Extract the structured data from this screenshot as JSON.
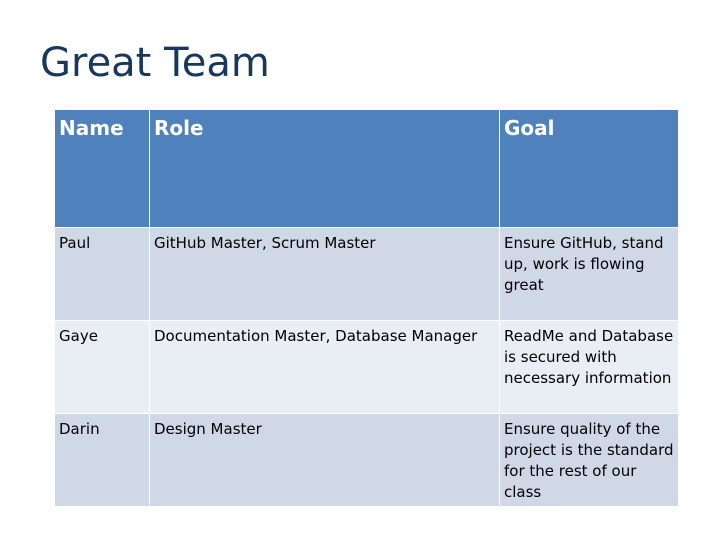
{
  "slide": {
    "title": "Great Team"
  },
  "table": {
    "headers": [
      "Name",
      "Role",
      "Goal"
    ],
    "rows": [
      {
        "name": "Paul",
        "role": "GitHub Master, Scrum Master",
        "goal": "Ensure GitHub, stand up, work is flowing great"
      },
      {
        "name": "Gaye",
        "role": "Documentation Master, Database Manager",
        "goal": "ReadMe and Database is secured with necessary information"
      },
      {
        "name": "Darin",
        "role": "Design Master",
        "goal": "Ensure quality of the project is the standard for the rest of our class"
      }
    ],
    "colors": {
      "header_bg": "#4f81bd",
      "row_odd_bg": "#d0d8e8",
      "row_even_bg": "#e9edf4",
      "title_color": "#17375e"
    }
  }
}
